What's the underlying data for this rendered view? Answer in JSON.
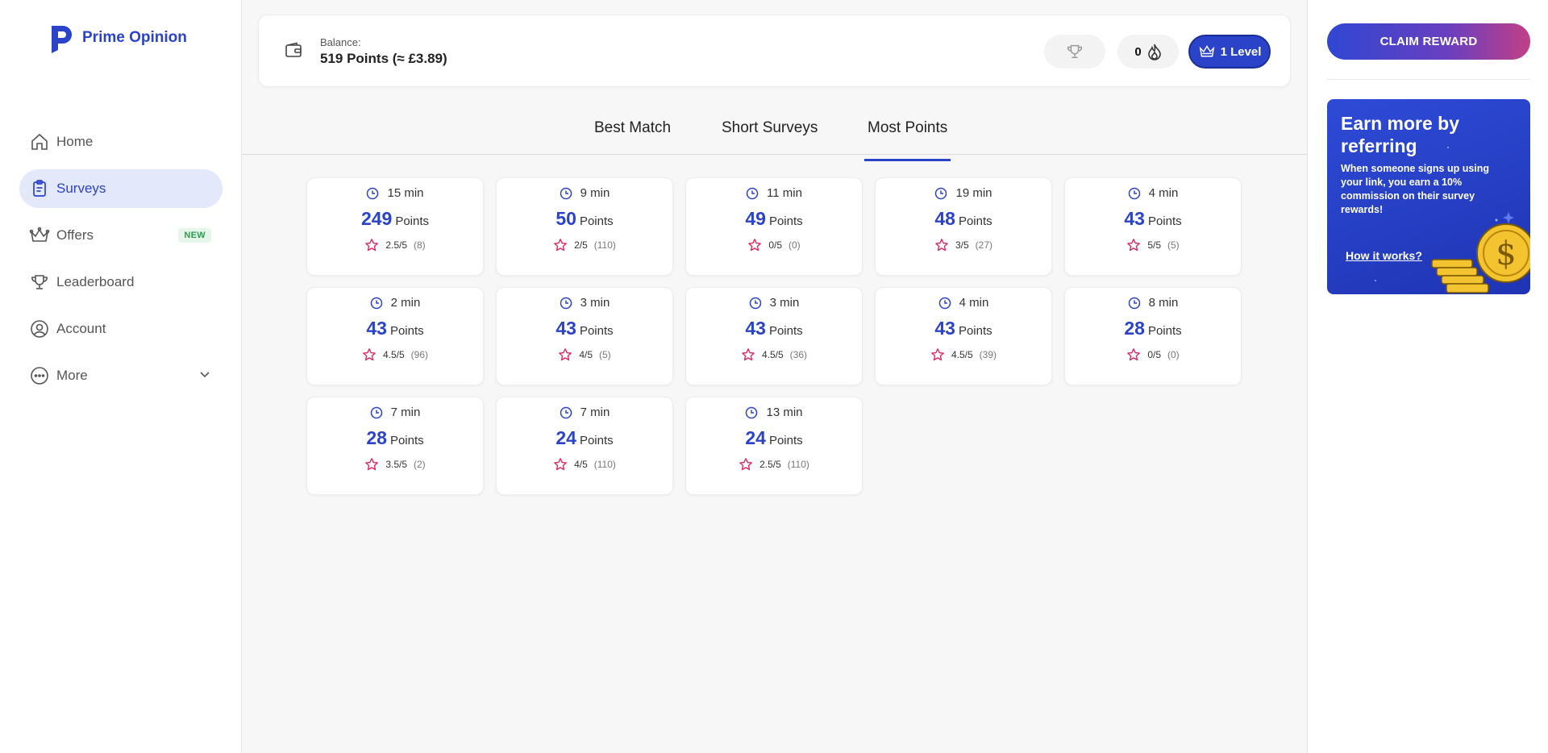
{
  "brand": {
    "name": "Prime Opinion"
  },
  "sidebar": {
    "items": [
      {
        "label": "Home",
        "icon": "home-icon"
      },
      {
        "label": "Surveys",
        "icon": "clipboard-icon",
        "active": true
      },
      {
        "label": "Offers",
        "icon": "crown-icon",
        "badge": "NEW"
      },
      {
        "label": "Leaderboard",
        "icon": "trophy-icon"
      },
      {
        "label": "Account",
        "icon": "user-circle-icon"
      },
      {
        "label": "More",
        "icon": "more-dots-icon"
      }
    ]
  },
  "header": {
    "balance_label": "Balance:",
    "balance_value": "519 Points (≈ £3.89)",
    "streak_count": "0",
    "level_label": "1 Level"
  },
  "tabs": [
    {
      "label": "Best Match"
    },
    {
      "label": "Short Surveys"
    },
    {
      "label": "Most Points",
      "active": true
    }
  ],
  "surveys": [
    {
      "time": "15 min",
      "points": "249",
      "points_label": "Points",
      "rating": "2.5/5",
      "count": "(8)"
    },
    {
      "time": "9 min",
      "points": "50",
      "points_label": "Points",
      "rating": "2/5",
      "count": "(110)"
    },
    {
      "time": "11 min",
      "points": "49",
      "points_label": "Points",
      "rating": "0/5",
      "count": "(0)"
    },
    {
      "time": "19 min",
      "points": "48",
      "points_label": "Points",
      "rating": "3/5",
      "count": "(27)"
    },
    {
      "time": "4 min",
      "points": "43",
      "points_label": "Points",
      "rating": "5/5",
      "count": "(5)"
    },
    {
      "time": "2 min",
      "points": "43",
      "points_label": "Points",
      "rating": "4.5/5",
      "count": "(96)"
    },
    {
      "time": "3 min",
      "points": "43",
      "points_label": "Points",
      "rating": "4/5",
      "count": "(5)"
    },
    {
      "time": "3 min",
      "points": "43",
      "points_label": "Points",
      "rating": "4.5/5",
      "count": "(36)"
    },
    {
      "time": "4 min",
      "points": "43",
      "points_label": "Points",
      "rating": "4.5/5",
      "count": "(39)"
    },
    {
      "time": "8 min",
      "points": "28",
      "points_label": "Points",
      "rating": "0/5",
      "count": "(0)"
    },
    {
      "time": "7 min",
      "points": "28",
      "points_label": "Points",
      "rating": "3.5/5",
      "count": "(2)"
    },
    {
      "time": "7 min",
      "points": "24",
      "points_label": "Points",
      "rating": "4/5",
      "count": "(110)"
    },
    {
      "time": "13 min",
      "points": "24",
      "points_label": "Points",
      "rating": "2.5/5",
      "count": "(110)"
    }
  ],
  "right_panel": {
    "claim_button": "CLAIM REWARD",
    "promo_title": "Earn more by referring",
    "promo_text": "When someone signs up using your link, you earn a 10% commission on their survey rewards!",
    "promo_link": "How it works?"
  },
  "colors": {
    "accent": "#2a43c9",
    "star": "#e0245e",
    "new_badge": "#2e9b4e"
  }
}
